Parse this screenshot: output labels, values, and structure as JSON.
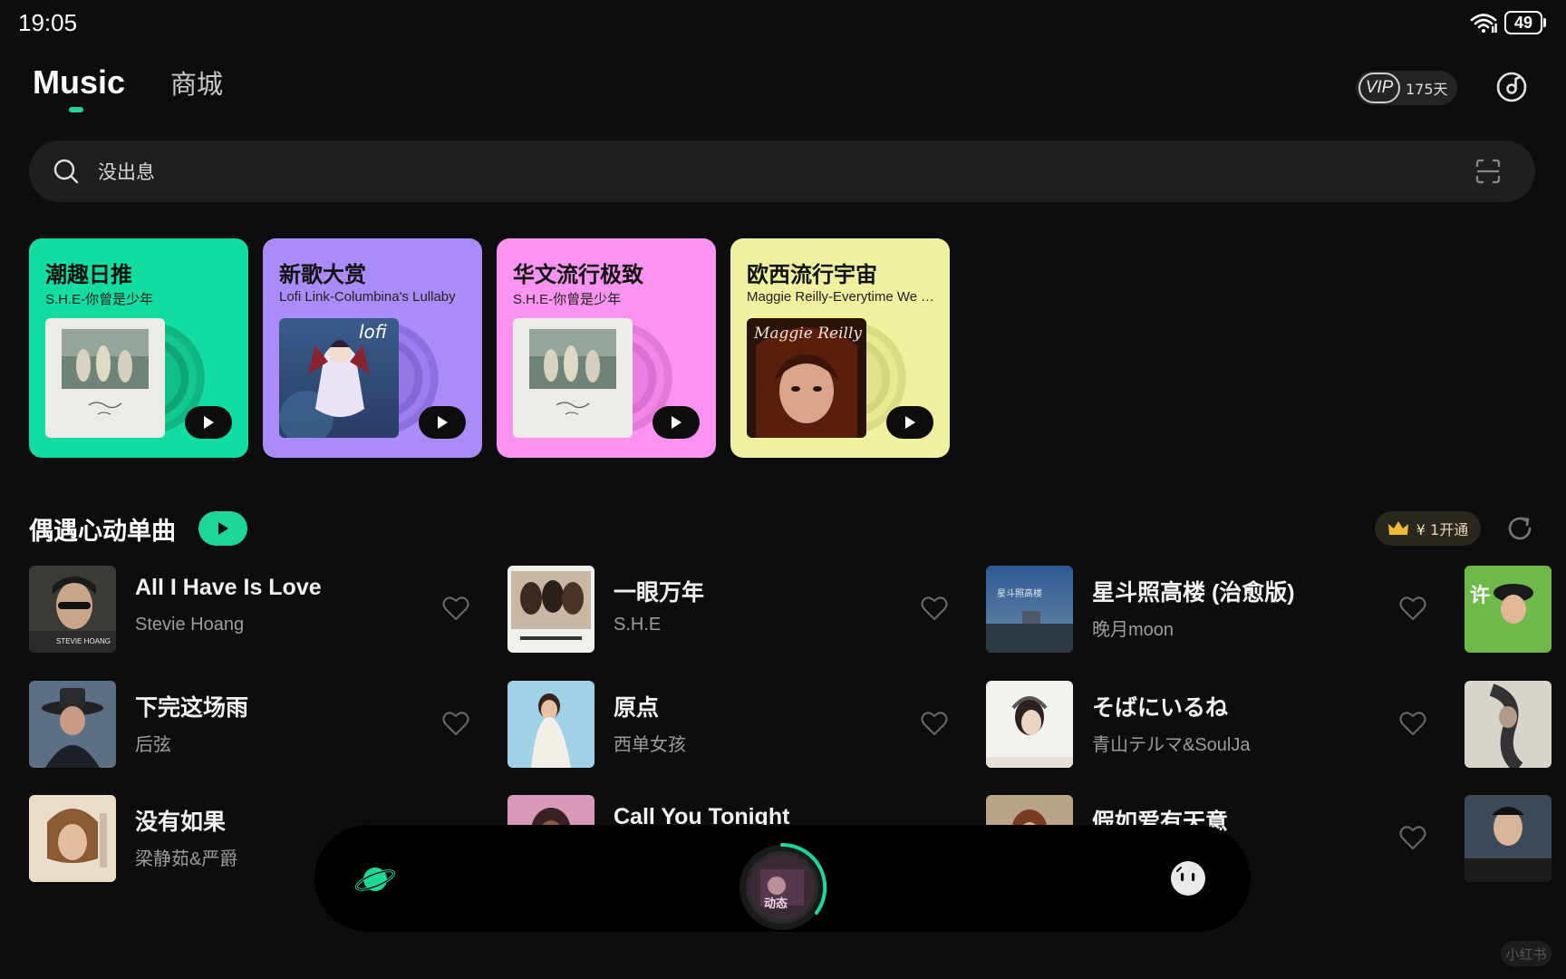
{
  "status": {
    "time": "19:05",
    "battery": "49"
  },
  "header": {
    "tab_music": "Music",
    "tab_store": "商城",
    "vip_label": "VIP",
    "vip_days": "175天"
  },
  "search": {
    "placeholder": "没出息"
  },
  "cards": [
    {
      "title": "潮趣日推",
      "subtitle": "S.H.E-你曾是少年",
      "color": "#12dca0"
    },
    {
      "title": "新歌大赏",
      "subtitle": "Lofi Link-Columbina's Lullaby",
      "color": "#a98cf7"
    },
    {
      "title": "华文流行极致",
      "subtitle": "S.H.E-你曾是少年",
      "color": "#fb93f1"
    },
    {
      "title": "欧西流行宇宙",
      "subtitle": "Maggie Reilly-Everytime We Touch",
      "color": "#eef29e"
    }
  ],
  "section": {
    "title": "偶遇心动单曲",
    "vip_offer": "¥ 1开通"
  },
  "songs": [
    {
      "title": "All I Have Is Love",
      "artist": "Stevie Hoang"
    },
    {
      "title": "一眼万年",
      "artist": "S.H.E"
    },
    {
      "title": "星斗照高楼 (治愈版)",
      "artist": "晚月moon"
    },
    {
      "title": "下完这场雨",
      "artist": "后弦"
    },
    {
      "title": "原点",
      "artist": "西单女孩"
    },
    {
      "title": "そばにいるね",
      "artist": "青山テルマ&SoulJa"
    },
    {
      "title": "没有如果",
      "artist": "梁静茹&严爵"
    },
    {
      "title": "Call You Tonight",
      "artist": ""
    },
    {
      "title": "假如爱有天意",
      "artist": ""
    }
  ],
  "watermark": "小红书",
  "colors": {
    "accent": "#1fd69a",
    "background": "#0d0d0d"
  }
}
